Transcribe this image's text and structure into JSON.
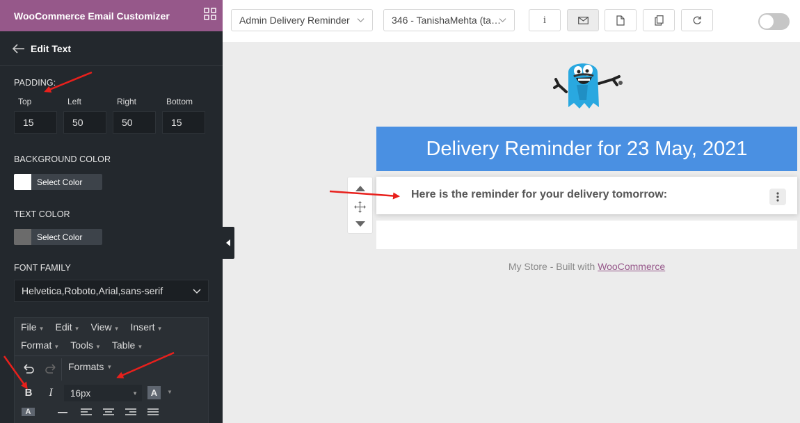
{
  "app": {
    "title": "WooCommerce Email Customizer",
    "back_label": "Edit Text"
  },
  "padding": {
    "section_label": "PADDING",
    "fields": [
      {
        "label": "Top",
        "value": "15"
      },
      {
        "label": "Left",
        "value": "50"
      },
      {
        "label": "Right",
        "value": "50"
      },
      {
        "label": "Bottom",
        "value": "15"
      }
    ]
  },
  "background_color": {
    "label": "BACKGROUND COLOR",
    "button": "Select Color",
    "swatch": "#ffffff"
  },
  "text_color": {
    "label": "TEXT COLOR",
    "button": "Select Color",
    "swatch": "#6b6b6b"
  },
  "font_family": {
    "label": "FONT FAMILY",
    "value": "Helvetica,Roboto,Arial,sans-serif"
  },
  "editor": {
    "menus_row1": [
      "File",
      "Edit",
      "View",
      "Insert"
    ],
    "menus_row2": [
      "Format",
      "Tools",
      "Table"
    ],
    "formats_label": "Formats",
    "font_size": "16px"
  },
  "topbar": {
    "template_select": "Admin Delivery Reminder",
    "order_select": "346 - TanishaMehta (ta…",
    "buttons": [
      {
        "name": "info",
        "icon": "info-icon"
      },
      {
        "name": "email",
        "icon": "envelope-icon"
      },
      {
        "name": "document",
        "icon": "document-icon"
      },
      {
        "name": "copy",
        "icon": "copy-icon"
      },
      {
        "name": "reset",
        "icon": "refresh-icon"
      }
    ],
    "toggle_on": false
  },
  "email": {
    "heading": "Delivery Reminder for 23 May, 2021",
    "body_text": "Here is the reminder for your delivery tomorrow:",
    "footer_prefix": "My Store - Built with",
    "footer_link": "WooCommerce"
  },
  "colors": {
    "sidebar_bg": "#23282d",
    "header_purple": "#96588a",
    "heading_blue": "#4a90e2",
    "annotation_red": "#e8201c"
  }
}
